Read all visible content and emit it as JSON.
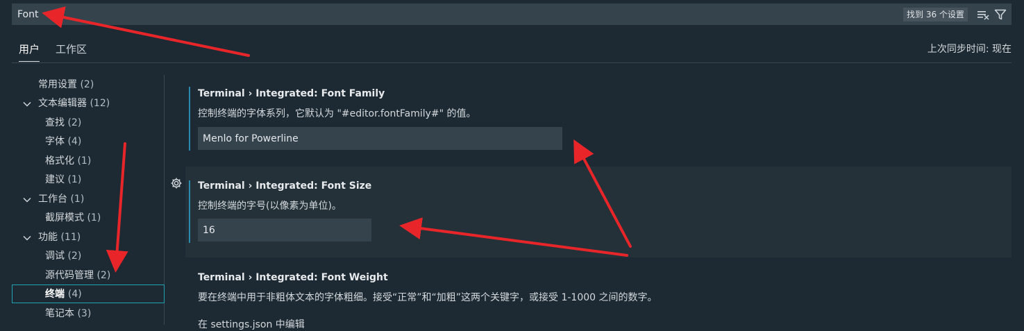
{
  "search": {
    "value": "Font",
    "result_count": "找到 36 个设置",
    "clear_filter_icon": "clear-filter-icon",
    "filter_icon": "filter-icon"
  },
  "tabs": [
    {
      "label": "用户",
      "active": true
    },
    {
      "label": "工作区",
      "active": false
    }
  ],
  "sync_status": "上次同步时间: 现在",
  "toc": [
    {
      "label": "常用设置",
      "count": "(2)",
      "chevron": false,
      "indent": 1
    },
    {
      "label": "文本编辑器",
      "count": "(12)",
      "chevron": true,
      "indent": 1
    },
    {
      "label": "查找",
      "count": "(2)",
      "chevron": false,
      "indent": 2
    },
    {
      "label": "字体",
      "count": "(4)",
      "chevron": false,
      "indent": 2
    },
    {
      "label": "格式化",
      "count": "(1)",
      "chevron": false,
      "indent": 2
    },
    {
      "label": "建议",
      "count": "(1)",
      "chevron": false,
      "indent": 2
    },
    {
      "label": "工作台",
      "count": "(1)",
      "chevron": true,
      "indent": 1
    },
    {
      "label": "截屏模式",
      "count": "(1)",
      "chevron": false,
      "indent": 2
    },
    {
      "label": "功能",
      "count": "(11)",
      "chevron": true,
      "indent": 1
    },
    {
      "label": "调试",
      "count": "(2)",
      "chevron": false,
      "indent": 2
    },
    {
      "label": "源代码管理",
      "count": "(2)",
      "chevron": false,
      "indent": 2
    },
    {
      "label": "终端",
      "count": "(4)",
      "chevron": false,
      "indent": 2,
      "selected": true
    },
    {
      "label": "笔记本",
      "count": "(3)",
      "chevron": false,
      "indent": 2
    }
  ],
  "settings": [
    {
      "title": "Terminal › Integrated: Font Family",
      "description": "控制终端的字体系列，它默认为 \"#editor.fontFamily#\" 的值。",
      "value": "Menlo for Powerline"
    },
    {
      "title": "Terminal › Integrated: Font Size",
      "description": "控制终端的字号(以像素为单位)。",
      "value": "16"
    },
    {
      "title": "Terminal › Integrated: Font Weight",
      "description": "要在终端中用于非粗体文本的字体粗细。接受“正常”和“加粗”这两个关键字，或接受 1-1000 之间的数字。",
      "edit_link": "在 settings.json 中编辑"
    }
  ],
  "colors": {
    "background": "#1e2a33",
    "input_background": "#35434d",
    "accent": "#22a3b3",
    "annotation_arrow": "#e8262a"
  }
}
